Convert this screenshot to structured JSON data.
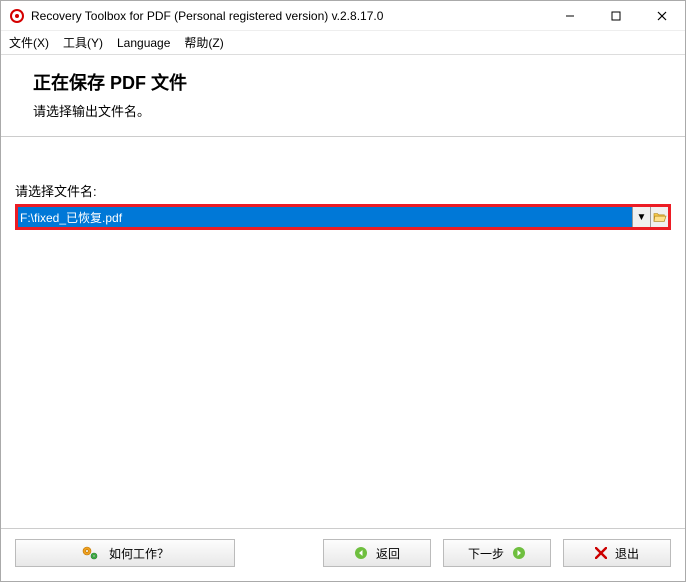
{
  "window": {
    "title": "Recovery Toolbox for PDF (Personal registered version) v.2.8.17.0"
  },
  "menu": {
    "file": "文件(X)",
    "tools": "工具(Y)",
    "language": "Language",
    "help": "帮助(Z)"
  },
  "header": {
    "heading": "正在保存 PDF 文件",
    "subheading": "请选择输出文件名。"
  },
  "field": {
    "label": "请选择文件名:",
    "value": "F:\\fixed_已恢复.pdf"
  },
  "footer": {
    "how": "如何工作？",
    "back": "返回",
    "next": "下一步",
    "exit": "退出"
  }
}
